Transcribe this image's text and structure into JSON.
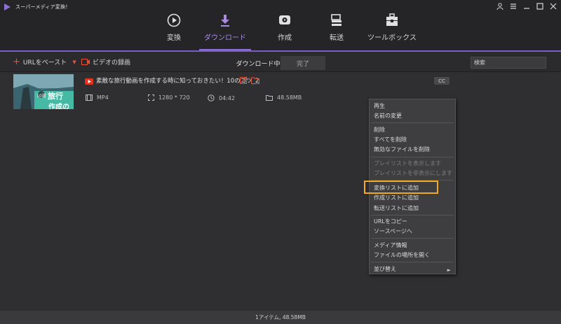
{
  "app": {
    "title": "スーパーメディア変換！"
  },
  "nav": [
    {
      "label": "変換",
      "icon": "convert-icon"
    },
    {
      "label": "ダウンロード",
      "icon": "download-icon",
      "active": true
    },
    {
      "label": "作成",
      "icon": "burn-disc-icon"
    },
    {
      "label": "転送",
      "icon": "transfer-icon"
    },
    {
      "label": "ツールボックス",
      "icon": "toolbox-icon"
    }
  ],
  "toolbar": {
    "paste_url_label": "URLをペースト",
    "record_label": "ビデオの録画",
    "tabs": {
      "downloading": "ダウンロード中",
      "completed": "完了"
    },
    "search_placeholder": "検索"
  },
  "item": {
    "thumbnail": {
      "badge": "10選",
      "text1": "旅行",
      "text2": "作成の"
    },
    "title": "素敵な旅行動画を作成する時に知っておきたい！10のコツ_2",
    "format": "MP4",
    "resolution": "1280 * 720",
    "duration": "04:42",
    "size": "48.58MB",
    "cc": "CC"
  },
  "context_menu": {
    "items": [
      {
        "label": "再生",
        "enabled": true
      },
      {
        "label": "名前の変更",
        "enabled": true
      },
      {
        "label": "削除",
        "enabled": true
      },
      {
        "label": "すべてを削除",
        "enabled": true
      },
      {
        "label": "無効なファイルを削除",
        "enabled": true
      },
      {
        "label": "プレイリストを表示します",
        "enabled": false
      },
      {
        "label": "プレイリストを非表示にします",
        "enabled": false
      },
      {
        "label": "変換リストに追加",
        "enabled": true,
        "highlighted": true
      },
      {
        "label": "作成リストに追加",
        "enabled": true
      },
      {
        "label": "転送リストに追加",
        "enabled": true
      },
      {
        "label": "URLをコピー",
        "enabled": true
      },
      {
        "label": "ソースページへ",
        "enabled": true
      },
      {
        "label": "メディア情報",
        "enabled": true
      },
      {
        "label": "ファイルの場所を開く",
        "enabled": true
      },
      {
        "label": "並び替え",
        "enabled": true,
        "has_submenu": true
      }
    ]
  },
  "status": {
    "text": "1アイテム, 48.58MB"
  },
  "colors": {
    "accent": "#8e6fd4",
    "highlight": "#f2a91d",
    "red": "#e2553e"
  }
}
